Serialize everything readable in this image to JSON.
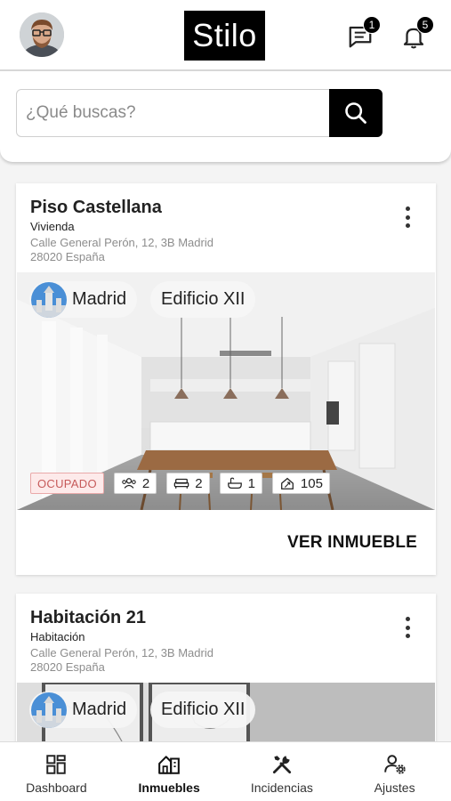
{
  "header": {
    "logo": "Stilo",
    "avatar_icon": "user-avatar",
    "messages": {
      "icon": "message-icon",
      "badge": "1"
    },
    "notifications": {
      "icon": "bell-icon",
      "badge": "5"
    }
  },
  "search": {
    "placeholder": "¿Qué buscas?",
    "icon": "search-icon"
  },
  "properties": [
    {
      "title": "Piso Castellana",
      "type": "Vivienda",
      "address_line1": "Calle General Perón, 12, 3B Madrid",
      "address_line2": "28020 España",
      "location_chip": "Madrid",
      "building_chip": "Edificio XII",
      "status": "OCUPADO",
      "tenants": "2",
      "bedrooms": "2",
      "bathrooms": "1",
      "area": "105",
      "cta": "VER INMUEBLE"
    },
    {
      "title": "Habitación 21",
      "type": "Habitación",
      "address_line1": "Calle General Perón, 12, 3B Madrid",
      "address_line2": "28020 España",
      "location_chip": "Madrid",
      "building_chip": "Edificio XII"
    }
  ],
  "nav": {
    "items": [
      {
        "label": "Dashboard",
        "icon": "dashboard-icon",
        "active": false
      },
      {
        "label": "Inmuebles",
        "icon": "building-icon",
        "active": true
      },
      {
        "label": "Incidencias",
        "icon": "tools-icon",
        "active": false
      },
      {
        "label": "Ajustes",
        "icon": "user-settings-icon",
        "active": false
      }
    ]
  },
  "colors": {
    "accent": "#000000",
    "status_bg": "#fdeaea",
    "status_text": "#c65a5a"
  }
}
